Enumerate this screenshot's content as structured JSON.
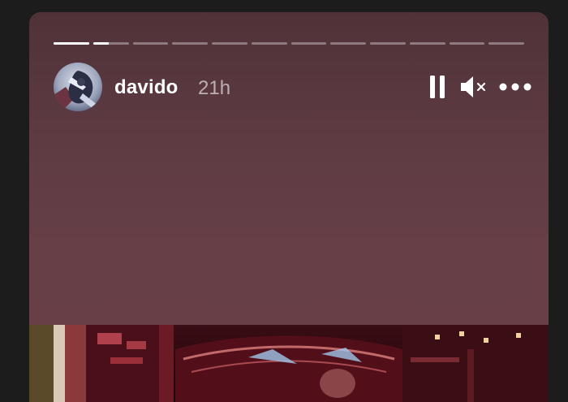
{
  "story": {
    "username": "davido",
    "timestamp": "21h",
    "segment_progress": [
      1,
      0.45,
      0,
      0,
      0,
      0,
      0,
      0,
      0,
      0,
      0,
      0
    ],
    "background_color": "#663f47"
  },
  "controls": {
    "pause_icon": "pause-icon",
    "mute_icon": "speaker-muted-icon",
    "more_icon": "more-horizontal-icon"
  }
}
